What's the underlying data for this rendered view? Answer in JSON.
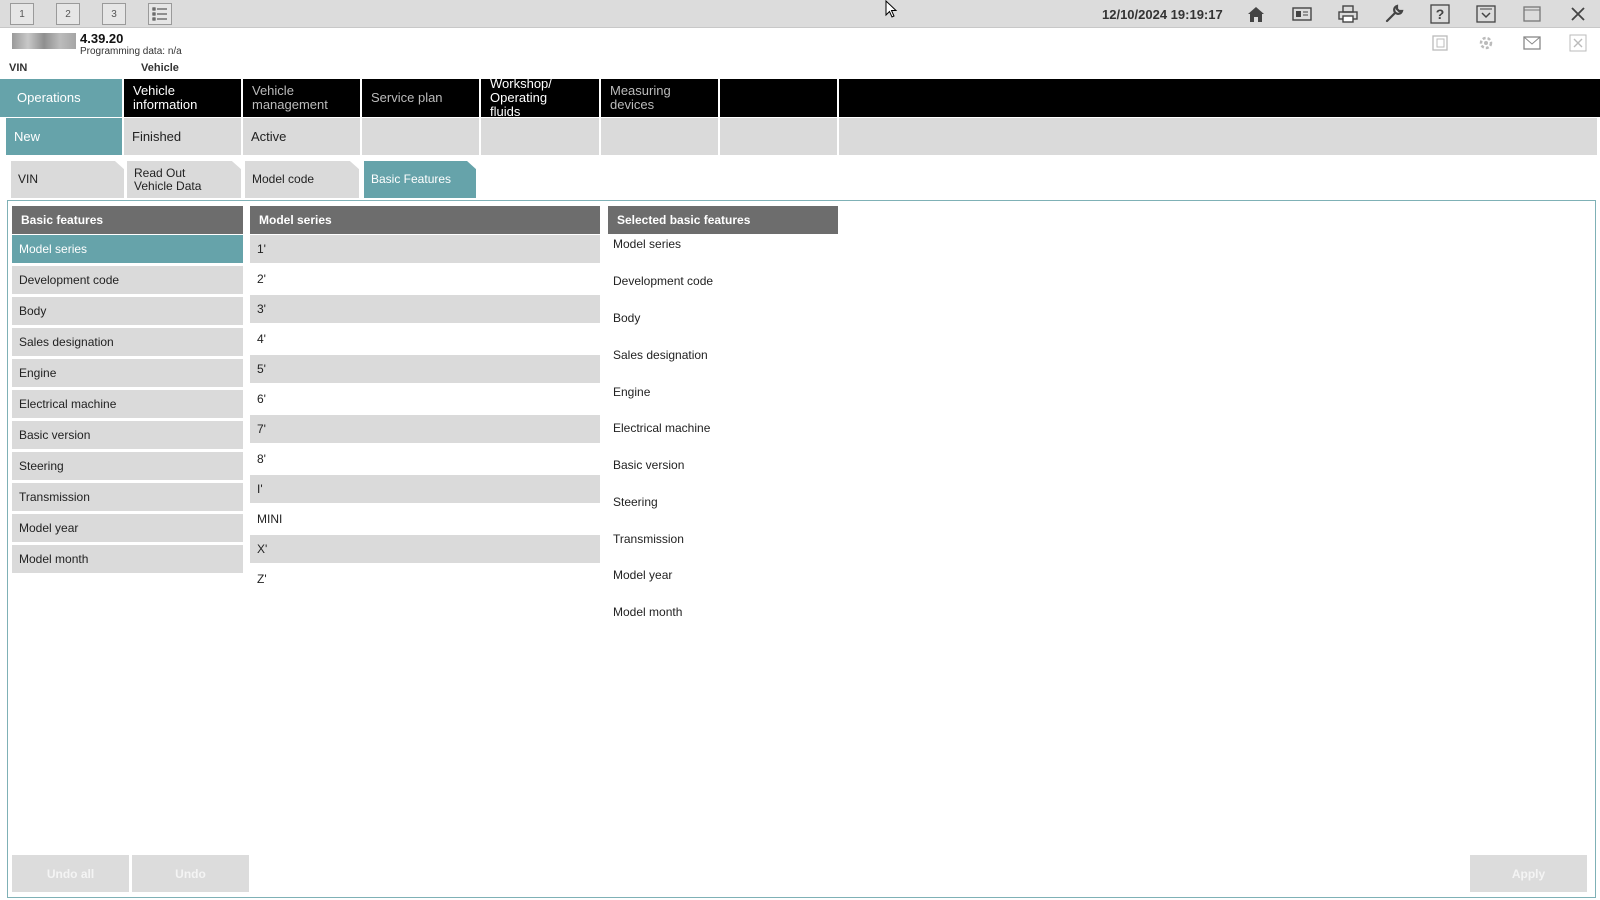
{
  "toolbar": {
    "workspace_buttons": [
      "1",
      "2",
      "3"
    ],
    "datetime": "12/10/2024 19:19:17"
  },
  "header": {
    "version": "4.39.20",
    "programming_data": "Programming data:  n/a"
  },
  "vehicle_row": {
    "vin_label": "VIN",
    "vehicle_label": "Vehicle"
  },
  "main_nav": {
    "items": [
      {
        "label": "Operations"
      },
      {
        "label": "Vehicle information"
      },
      {
        "label": "Vehicle management"
      },
      {
        "label": "Service plan"
      },
      {
        "label": "Workshop/ Operating fluids"
      },
      {
        "label": "Measuring devices"
      }
    ]
  },
  "sub_nav": {
    "items": [
      {
        "label": "New"
      },
      {
        "label": "Finished"
      },
      {
        "label": "Active"
      }
    ]
  },
  "steps": {
    "items": [
      {
        "label": "VIN"
      },
      {
        "label": "Read Out Vehicle Data"
      },
      {
        "label": "Model code"
      },
      {
        "label": "Basic Features"
      }
    ]
  },
  "basic_features": {
    "header": "Basic features",
    "items": [
      "Model series",
      "Development code",
      "Body",
      "Sales designation",
      "Engine",
      "Electrical machine",
      "Basic version",
      "Steering",
      "Transmission",
      "Model year",
      "Model month"
    ]
  },
  "model_series": {
    "header": "Model series",
    "items": [
      "1'",
      "2'",
      "3'",
      "4'",
      "5'",
      "6'",
      "7'",
      "8'",
      "I'",
      "MINI",
      "X'",
      "Z'"
    ]
  },
  "selected_features": {
    "header": "Selected basic features",
    "items": [
      "Model series",
      "Development code",
      "Body",
      "Sales designation",
      "Engine",
      "Electrical machine",
      "Basic version",
      "Steering",
      "Transmission",
      "Model year",
      "Model month"
    ]
  },
  "buttons": {
    "undo_all": "Undo all",
    "undo": "Undo",
    "apply": "Apply"
  },
  "colors": {
    "accent": "#66a3aa",
    "nav_bg": "#000000",
    "header_bg": "#6d6d6d",
    "item_bg": "#dadada"
  }
}
